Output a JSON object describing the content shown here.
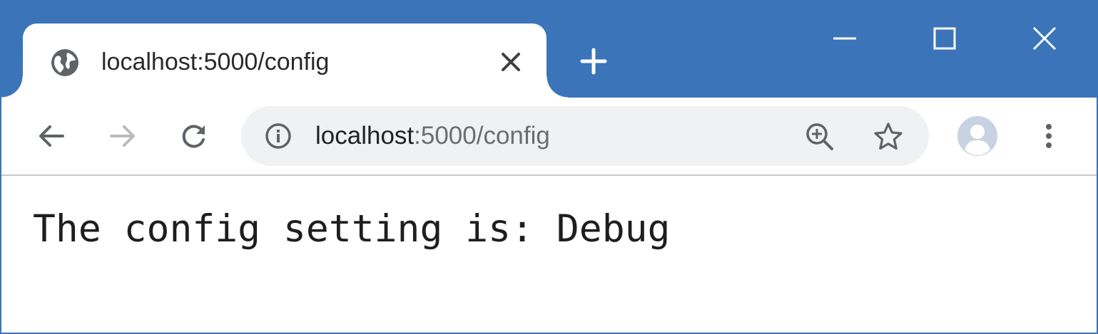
{
  "window": {
    "accent_color": "#3b74b8"
  },
  "tab": {
    "favicon_icon": "globe-icon",
    "title": "localhost:5000/config",
    "close_icon": "close-icon"
  },
  "new_tab": {
    "icon": "plus-icon"
  },
  "window_controls": {
    "minimize_icon": "minimize-icon",
    "maximize_icon": "maximize-icon",
    "close_icon": "window-close-icon"
  },
  "toolbar": {
    "back_icon": "back-arrow-icon",
    "forward_icon": "forward-arrow-icon",
    "reload_icon": "reload-icon",
    "omnibox": {
      "info_icon": "info-icon",
      "url_host": "localhost",
      "url_rest": ":5000/config",
      "zoom_icon": "zoom-in-icon",
      "bookmark_icon": "star-icon"
    },
    "avatar_icon": "profile-avatar-icon",
    "menu_icon": "kebab-menu-icon"
  },
  "page": {
    "text": "The config setting is: Debug"
  }
}
